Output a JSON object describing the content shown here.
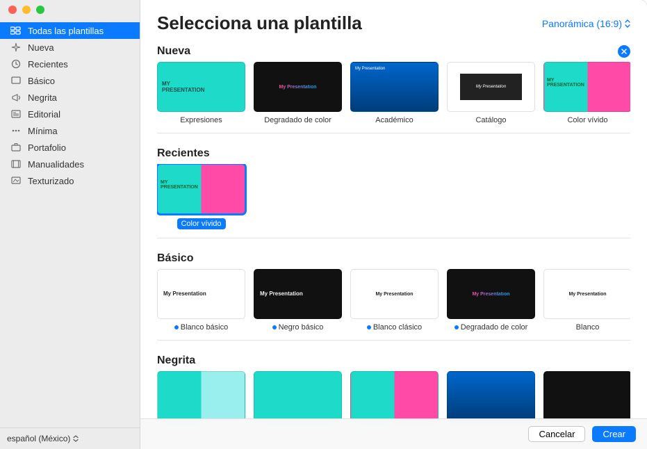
{
  "window": {
    "title": "Selecciona una plantilla"
  },
  "aspect": {
    "label": "Panorámica (16:9)"
  },
  "sidebar": {
    "items": [
      {
        "label": "Todas las plantillas",
        "icon": "grid-icon",
        "selected": true
      },
      {
        "label": "Nueva",
        "icon": "sparkle-icon"
      },
      {
        "label": "Recientes",
        "icon": "clock-icon"
      },
      {
        "label": "Básico",
        "icon": "square-icon"
      },
      {
        "label": "Negrita",
        "icon": "megaphone-icon"
      },
      {
        "label": "Editorial",
        "icon": "newspaper-icon"
      },
      {
        "label": "Mínima",
        "icon": "dots-icon"
      },
      {
        "label": "Portafolio",
        "icon": "briefcase-icon"
      },
      {
        "label": "Manualidades",
        "icon": "film-icon"
      },
      {
        "label": "Texturizado",
        "icon": "texture-icon"
      }
    ]
  },
  "language": {
    "label": "español (México)"
  },
  "sections": [
    {
      "title": "Nueva",
      "close": true,
      "templates": [
        {
          "label": "Expresiones",
          "style": "t-express"
        },
        {
          "label": "Degradado de color",
          "style": "t-gradient"
        },
        {
          "label": "Académico",
          "style": "t-academic"
        },
        {
          "label": "Catálogo",
          "style": "t-catalog"
        },
        {
          "label": "Color vívido",
          "style": "t-vivid"
        }
      ]
    },
    {
      "title": "Recientes",
      "templates": [
        {
          "label": "Color vívido",
          "style": "t-vivid",
          "selected": true
        }
      ]
    },
    {
      "title": "Básico",
      "templates": [
        {
          "label": "Blanco básico",
          "style": "t-whitebasic",
          "dynamic": true
        },
        {
          "label": "Negro básico",
          "style": "t-blackbasic",
          "dynamic": true
        },
        {
          "label": "Blanco clásico",
          "style": "t-whiteclassic",
          "dynamic": true
        },
        {
          "label": "Degradado de color",
          "style": "t-gradbasic",
          "dynamic": true
        },
        {
          "label": "Blanco",
          "style": "t-blanco"
        }
      ]
    },
    {
      "title": "Negrita",
      "templates": [
        {
          "label": "",
          "style": "t-bold1"
        },
        {
          "label": "",
          "style": "t-bold2"
        },
        {
          "label": "",
          "style": "t-bold3"
        },
        {
          "label": "",
          "style": "t-bold4"
        },
        {
          "label": "",
          "style": "t-bold5"
        }
      ]
    }
  ],
  "footer": {
    "cancel": "Cancelar",
    "create": "Crear"
  }
}
